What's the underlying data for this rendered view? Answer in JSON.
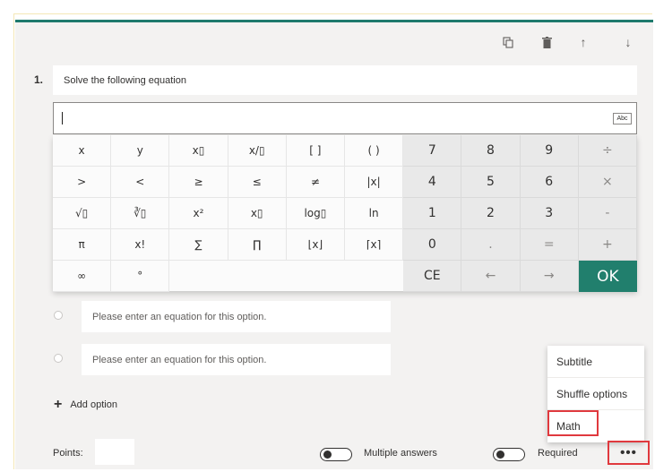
{
  "toolbar": {
    "copy_icon": "copy-icon",
    "delete_icon": "trash-icon",
    "up_icon": "arrow-up-icon",
    "down_icon": "arrow-down-icon",
    "copy_glyph": "⧉",
    "delete_glyph": "🗑",
    "up_glyph": "↑",
    "down_glyph": "↓"
  },
  "question": {
    "number": "1.",
    "title": "Solve the following equation",
    "input_value": "",
    "abc_label": "Abc"
  },
  "keypad": {
    "rows": [
      [
        "x",
        "y",
        "x▯",
        "x/▯",
        "[ ]",
        "( )",
        "7",
        "8",
        "9",
        "÷"
      ],
      [
        ">",
        "<",
        "≥",
        "≤",
        "≠",
        "|x|",
        "4",
        "5",
        "6",
        "×"
      ],
      [
        "√▯",
        "∛▯",
        "x²",
        "x▯",
        "log▯",
        "ln",
        "1",
        "2",
        "3",
        "-"
      ],
      [
        "π",
        "x!",
        "∑",
        "∏",
        "⌊x⌋",
        "⌈x⌉",
        "0",
        ".",
        "=",
        "+"
      ],
      [
        "∞",
        "°",
        "",
        "",
        "",
        "",
        "CE",
        "←",
        "→",
        "OK"
      ]
    ]
  },
  "options": [
    {
      "placeholder": "Please enter an equation for this option."
    },
    {
      "placeholder": "Please enter an equation for this option."
    }
  ],
  "add_option": {
    "plus": "+",
    "label": "Add option"
  },
  "menu": {
    "items": [
      "Subtitle",
      "Shuffle options",
      "Math"
    ]
  },
  "footer": {
    "points_label": "Points:",
    "points_value": "",
    "multiple_answers_label": "Multiple answers",
    "required_label": "Required",
    "more_label": "•••"
  },
  "colors": {
    "accent": "#217f6d",
    "highlight": "#e0393e",
    "card_bg": "#f3f2f1"
  }
}
